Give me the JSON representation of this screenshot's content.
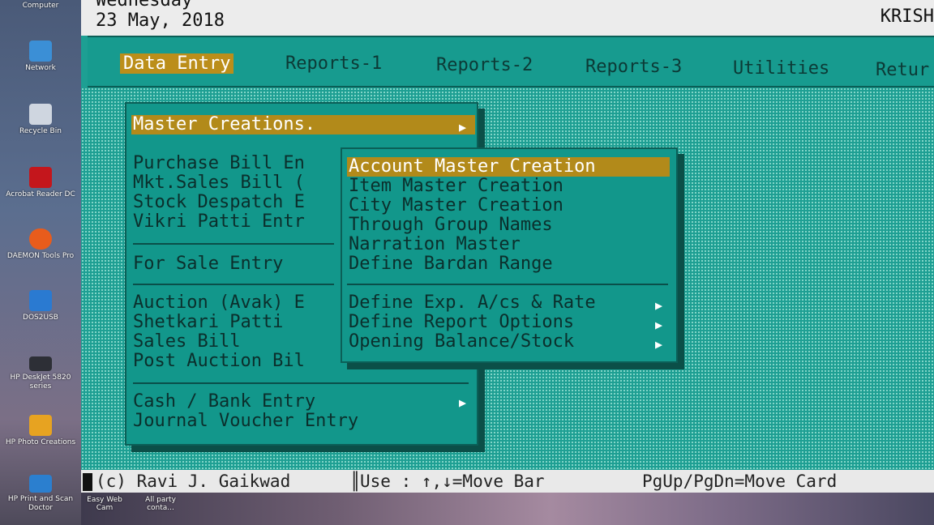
{
  "desktop": {
    "icons": [
      {
        "label": "Computer",
        "icon": "computer-icon",
        "color": "#6e8fc4"
      },
      {
        "label": "Network",
        "icon": "network-icon",
        "color": "#3b8fd6"
      },
      {
        "label": "Recycle Bin",
        "icon": "recycle-bin-icon",
        "color": "#cfd6e0"
      },
      {
        "label": "Acrobat Reader DC",
        "icon": "acrobat-icon",
        "color": "#c4161c"
      },
      {
        "label": "DAEMON Tools Pro",
        "icon": "daemon-tools-icon",
        "color": "#e85c1c"
      },
      {
        "label": "DOS2USB",
        "icon": "dos2usb-icon",
        "color": "#2a7ad1"
      },
      {
        "label": "HP DeskJet 5820 series",
        "icon": "printer-icon",
        "color": "#2d2f36"
      },
      {
        "label": "HP Photo Creations",
        "icon": "photo-icon",
        "color": "#e7a321"
      },
      {
        "label": "HP Print and Scan Doctor",
        "icon": "scan-doctor-icon",
        "color": "#2b7fcf"
      }
    ],
    "bottom_labels": [
      "Easy Web Cam",
      "All party conta..."
    ]
  },
  "header": {
    "day": "Wednesday",
    "date": "23 May, 2018",
    "user": "KRISH"
  },
  "menubar": {
    "items": [
      "Data Entry",
      "Reports-1",
      "Reports-2",
      "Reports-3",
      "Utilities",
      "Retur"
    ]
  },
  "data_entry_menu": {
    "master": "Master Creations.",
    "group1": [
      "Purchase Bill En",
      "Mkt.Sales Bill (",
      "Stock Despatch E",
      "Vikri Patti Entr"
    ],
    "group2": [
      "For Sale Entry"
    ],
    "group3": [
      "Auction (Avak) E",
      "Shetkari Patti",
      "Sales Bill",
      "Post Auction Bil"
    ],
    "group4": [
      "Cash / Bank Entry",
      "Journal Voucher Entry"
    ]
  },
  "master_submenu": {
    "group1": [
      "Account Master Creation",
      "Item Master Creation",
      "City Master Creation",
      "Through Group Names",
      "Narration Master",
      "Define Bardan Range"
    ],
    "group2": [
      "Define Exp. A/cs & Rate",
      "Define Report Options",
      "Opening Balance/Stock"
    ]
  },
  "statusbar": {
    "copyright": "(c) Ravi J. Gaikwad",
    "hint": "Use :  ↑,↓=Move Bar",
    "hint2": "PgUp/PgDn=Move Card"
  },
  "colors": {
    "screen": "#1d9f93",
    "highlight": "#b28a1a",
    "text": "#0b2f2c"
  }
}
